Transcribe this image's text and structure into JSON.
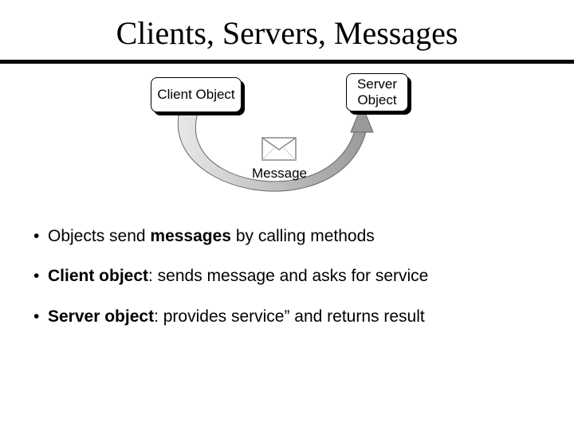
{
  "title": "Clients, Servers, Messages",
  "diagram": {
    "client_label": "Client Object",
    "server_label": "Server\nObject",
    "message_label": "Message"
  },
  "bullets": [
    {
      "pre": "Objects send ",
      "bold": "messages",
      "post": " by calling methods"
    },
    {
      "pre": "",
      "bold": "Client object",
      "post": ": sends message and asks for service"
    },
    {
      "pre": "",
      "bold": "Server object",
      "post": ": provides service” and returns result"
    }
  ]
}
